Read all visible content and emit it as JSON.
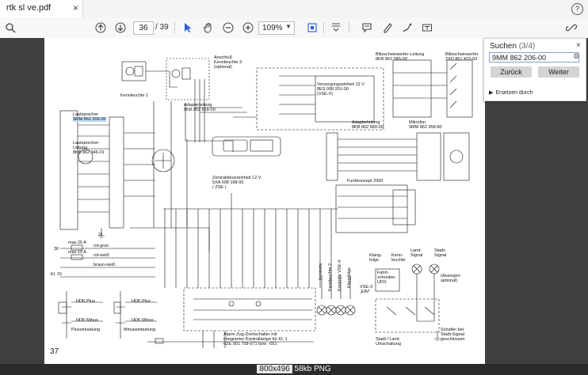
{
  "window": {
    "tab_title": "rtk sl ve.pdf",
    "close": "×",
    "help": "?"
  },
  "toolbar": {
    "current_page": "36",
    "total_pages": "/ 39",
    "zoom": "109%"
  },
  "search_panel": {
    "title": "Suchen",
    "count": "(3/4)",
    "close": "×",
    "query": "9MM 862 206-00",
    "back": "Zurück",
    "next": "Weiter",
    "replace": "Ersetzen durch"
  },
  "page_number": "37",
  "status": {
    "size": "800x496",
    "file": "58kb PNG"
  },
  "diagram": {
    "kennleuchte1": "Kennleuchte 1",
    "anschluss": "Anschluß\nKennleuchte 3\n(optional)",
    "adapter618": "Adapterleitung\n8KB 862 618-00",
    "lautsprecher": "Lautsprecher",
    "lautsprecher_nr": "9MM 862 206-00",
    "ls_leitung": "Lautsprecher-\nLeitung\n8KB 862 346-01",
    "blitz_leitung": "Blitzscheinwerfer-Leitung\n8KB 862 345-00",
    "blitz": "Blitzscheinwerfer\n2XD 861 423-03",
    "versorgung": "Versorgungseinheit 12 V\n8ES 008 201-00\n(VSE-X)",
    "adapter689": "Adapterleitung\n8KB 862 689-00",
    "mikrofon": "Mikrofon\n9MM 862 358-80",
    "zentral": "Zentralsteuereinheit 12 V\n5XA 008 198-00\n( ZSE )",
    "funkkonzept": "Funkkonzept 2000",
    "fahrt": "Fahrt-\nschreiber\nUDS",
    "klang": "Klang-\nfolge",
    "kennleuchte": "Kenn-\nleuchte",
    "land": "Land-\nSignal",
    "stadt": "Stadt-\nSignal",
    "anzeigen": "(Anzeigen\noptional)",
    "vse_ein": "VSE-X\n„EIN\"",
    "plus": "Pluseintastung",
    "minus": "Minuseintastung",
    "hdk_plus": "HDK Plus",
    "hdk_minus": "HDK Minus",
    "alarm": "Alarm-Zug-Drehschalter mit\nintegrierter Kontrollampe für Kl. 1\n6ZE 001 759-071 bzw. -051",
    "stadt_land": "Stadt / Land\nUmschaltung",
    "schalter": "Schalter bei\nStadt-Signal\ngeschlossen",
    "kontroll": [
      "Kontrolle",
      "Kennleuchte 2",
      "Kontrolle VSE-X",
      "Klangfolge"
    ],
    "max25": "max.25 A",
    "max10": "max.10 A",
    "rot_gruen": "rot-grün",
    "rot_weiss": "rot-weiß",
    "braun_weiss": "braun-weiß",
    "kl15": "Kl. 15",
    "kl31": "31",
    "kl30": "30"
  }
}
